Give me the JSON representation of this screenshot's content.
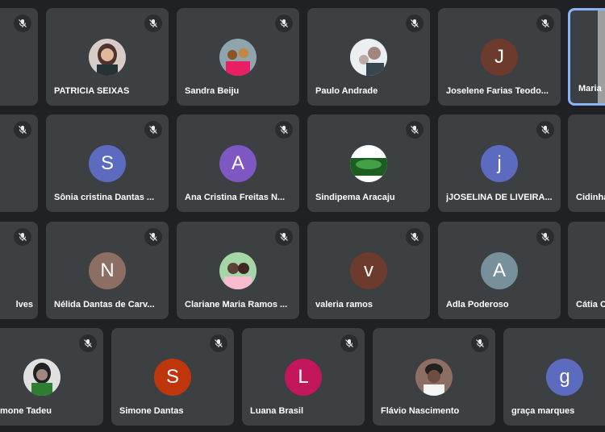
{
  "participants": [
    {
      "name": "PATRICIA SEIXAS",
      "avatar": "photo-woman",
      "muted": true
    },
    {
      "name": "Sandra Beiju",
      "avatar": "photo-group",
      "muted": true
    },
    {
      "name": "Paulo Andrade",
      "avatar": "photo-man",
      "muted": true
    },
    {
      "name": "Joselene Farias Teodo...",
      "initial": "J",
      "color": "#6d3a2e",
      "muted": true
    },
    {
      "name": "Maria",
      "avatar": "photo-partial",
      "muted": false,
      "active": true
    },
    {
      "name": "",
      "muted": true
    },
    {
      "name": "Sônia cristina Dantas ...",
      "initial": "S",
      "color": "#5c6bc0",
      "muted": true
    },
    {
      "name": "Ana Cristina Freitas N...",
      "initial": "A",
      "color": "#7e57c2",
      "muted": true
    },
    {
      "name": "Sindipema Aracaju",
      "avatar": "photo-logo",
      "muted": true
    },
    {
      "name": "jJOSELINA DE LIVEIRA...",
      "initial": "j",
      "color": "#5c6bc0",
      "muted": true
    },
    {
      "name": "Cidinha",
      "muted": false
    },
    {
      "name": "lves",
      "muted": true
    },
    {
      "name": "Nélida Dantas de Carv...",
      "initial": "N",
      "color": "#8d6e63",
      "muted": true
    },
    {
      "name": "Clariane Maria Ramos ...",
      "avatar": "photo-couple",
      "muted": true
    },
    {
      "name": "valeria ramos",
      "initial": "v",
      "color": "#6d3a2e",
      "muted": true
    },
    {
      "name": "Adla Poderoso",
      "initial": "A",
      "color": "#78909c",
      "muted": true
    },
    {
      "name": "Cátia C",
      "muted": false
    },
    {
      "name": "mone Tadeu",
      "avatar": "photo-woman2",
      "muted": true
    },
    {
      "name": "Simone Dantas",
      "initial": "S",
      "color": "#bf360c",
      "muted": true
    },
    {
      "name": "Luana Brasil",
      "initial": "L",
      "color": "#c2185b",
      "muted": true
    },
    {
      "name": "Flávio Nascimento",
      "avatar": "photo-man2",
      "muted": true
    },
    {
      "name": "graça marques",
      "initial": "g",
      "color": "#5c6bc0",
      "muted": true
    }
  ]
}
